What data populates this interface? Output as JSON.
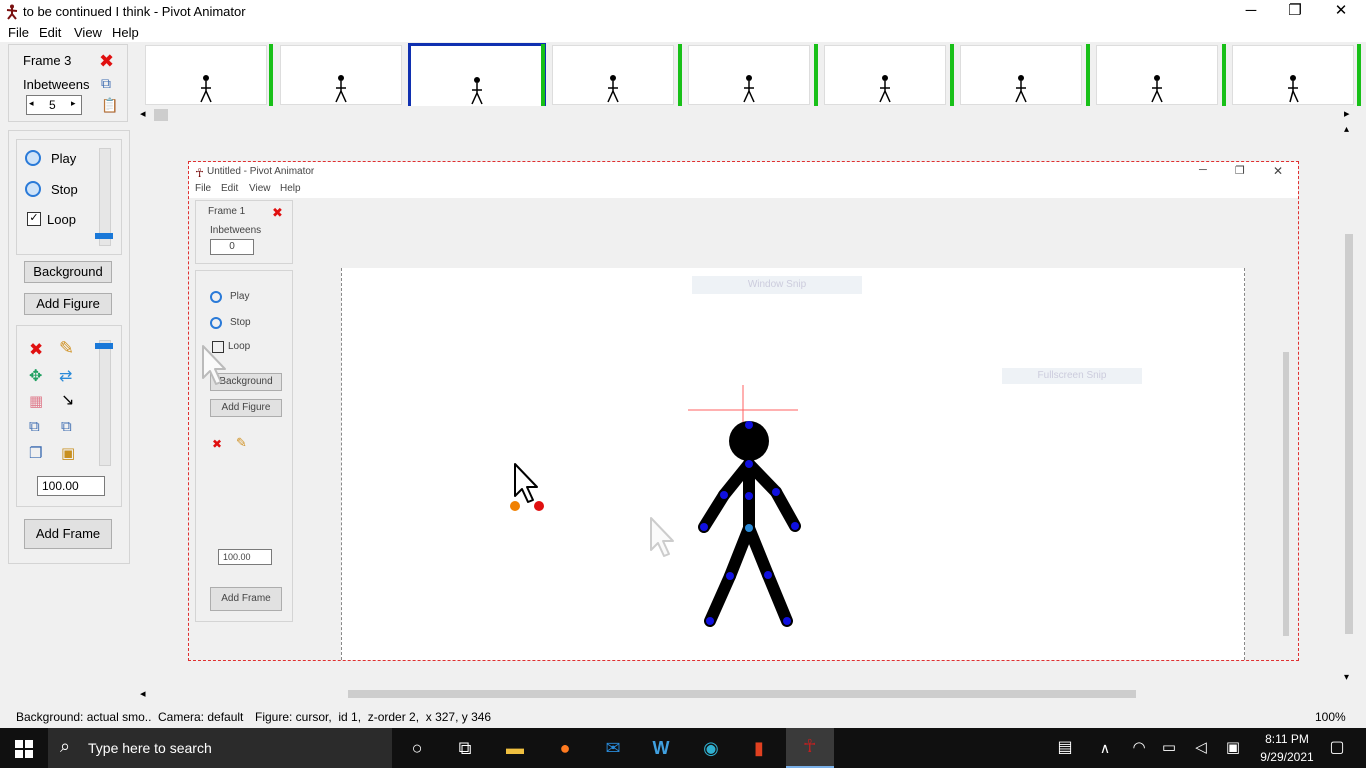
{
  "window": {
    "title": "to be continued I think - Pivot Animator",
    "menu": [
      "File",
      "Edit",
      "View",
      "Help"
    ]
  },
  "frame_panel": {
    "frame_label": "Frame 3",
    "inbetweens_label": "Inbetweens",
    "inbetweens_value": "5"
  },
  "playback": {
    "play_label": "Play",
    "stop_label": "Stop",
    "loop_label": "Loop",
    "loop_checked": true
  },
  "buttons": {
    "background": "Background",
    "add_figure": "Add Figure",
    "add_frame": "Add Frame"
  },
  "figure_scale": "100.00",
  "status": {
    "background": "Background: actual smo..",
    "camera": "Camera: default",
    "figure": "Figure: cursor,  id 1,  z-order 2,  x 327, y 346",
    "zoom": "100%"
  },
  "nested_window": {
    "title": "Untitled - Pivot Animator",
    "menu": [
      "File",
      "Edit",
      "View",
      "Help"
    ],
    "frame_label": "Frame 1",
    "inbetweens_label": "Inbetweens",
    "inbetweens_value": "0",
    "play_label": "Play",
    "stop_label": "Stop",
    "loop_label": "Loop",
    "background": "Background",
    "add_figure": "Add Figure",
    "add_frame": "Add Frame",
    "scale": "100.00",
    "ghost_text_1": "Window Snip",
    "ghost_text_2": "Fullscreen Snip"
  },
  "taskbar": {
    "search_placeholder": "Type here to search",
    "time": "8:11 PM",
    "date": "9/29/2021"
  },
  "colors": {
    "selected_frame_border": "#1030b0",
    "frame_divider": "#18c018",
    "joint_blue": "#1010e0",
    "joint_red": "#e01010",
    "joint_orange": "#f08000"
  }
}
